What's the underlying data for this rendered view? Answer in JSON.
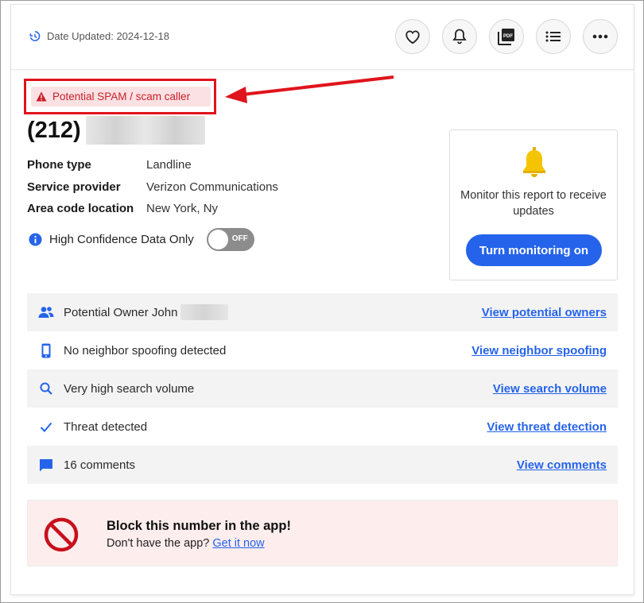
{
  "header": {
    "date_updated": "Date Updated: 2024-12-18",
    "actions": [
      "favorite-icon",
      "bell-icon",
      "pdf-icon",
      "list-icon",
      "more-icon"
    ]
  },
  "alert": {
    "spam_label": "Potential SPAM / scam caller",
    "color": "#c8202a",
    "highlight_color": "#e0141c"
  },
  "phone": {
    "area_code": "(212)"
  },
  "details": [
    {
      "label": "Phone type",
      "value": "Landline"
    },
    {
      "label": "Service provider",
      "value": "Verizon Communications"
    },
    {
      "label": "Area code location",
      "value": "New York, Ny"
    }
  ],
  "confidence": {
    "label": "High Confidence Data Only",
    "toggle_state": "OFF"
  },
  "monitor": {
    "text": "Monitor this report to receive updates",
    "button": "Turn monitoring on",
    "accent": "#2563eb"
  },
  "features": [
    {
      "icon": "people-icon",
      "text": "Potential Owner John",
      "link": "View potential owners"
    },
    {
      "icon": "phone-icon",
      "text": "No neighbor spoofing detected",
      "link": "View neighbor spoofing"
    },
    {
      "icon": "search-icon",
      "text": "Very high search volume",
      "link": "View search volume"
    },
    {
      "icon": "check-icon",
      "text": "Threat detected",
      "link": "View threat detection"
    },
    {
      "icon": "comment-icon",
      "text": "16 comments",
      "link": "View comments"
    }
  ],
  "block": {
    "title": "Block this number in the app!",
    "subtitle": "Don't have the app?",
    "link": "Get it now"
  }
}
